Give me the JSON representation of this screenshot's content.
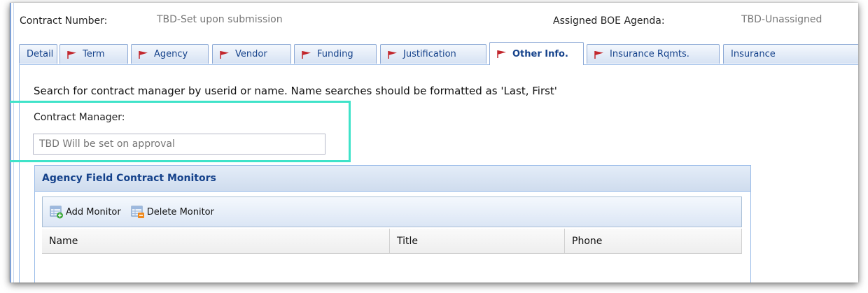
{
  "header": {
    "contract_number_label": "Contract Number:",
    "contract_number_value": "TBD-Set upon submission",
    "boe_agenda_label": "Assigned BOE Agenda:",
    "boe_agenda_value": "TBD-Unassigned"
  },
  "tabs": [
    {
      "label": "Detail",
      "flag": false,
      "active": false
    },
    {
      "label": "Term",
      "flag": true,
      "active": false
    },
    {
      "label": "Agency",
      "flag": true,
      "active": false
    },
    {
      "label": "Vendor",
      "flag": true,
      "active": false
    },
    {
      "label": "Funding",
      "flag": true,
      "active": false
    },
    {
      "label": "Justification",
      "flag": true,
      "active": false
    },
    {
      "label": "Other Info.",
      "flag": true,
      "active": true
    },
    {
      "label": "Insurance Rqmts.",
      "flag": true,
      "active": false
    },
    {
      "label": "Insurance",
      "flag": false,
      "active": false
    }
  ],
  "main": {
    "instructions": "Search for contract manager by userid or name. Name searches should be formatted as 'Last, First'",
    "contract_manager_label": "Contract Manager:",
    "contract_manager_placeholder": "TBD Will be set on approval"
  },
  "monitors": {
    "title": "Agency Field Contract Monitors",
    "add_label": "Add Monitor",
    "delete_label": "Delete Monitor",
    "columns": [
      "Name",
      "Title",
      "Phone"
    ]
  },
  "colors": {
    "highlight": "#3fe3c9",
    "flag": "#c2272d",
    "tab_text": "#15428b"
  }
}
